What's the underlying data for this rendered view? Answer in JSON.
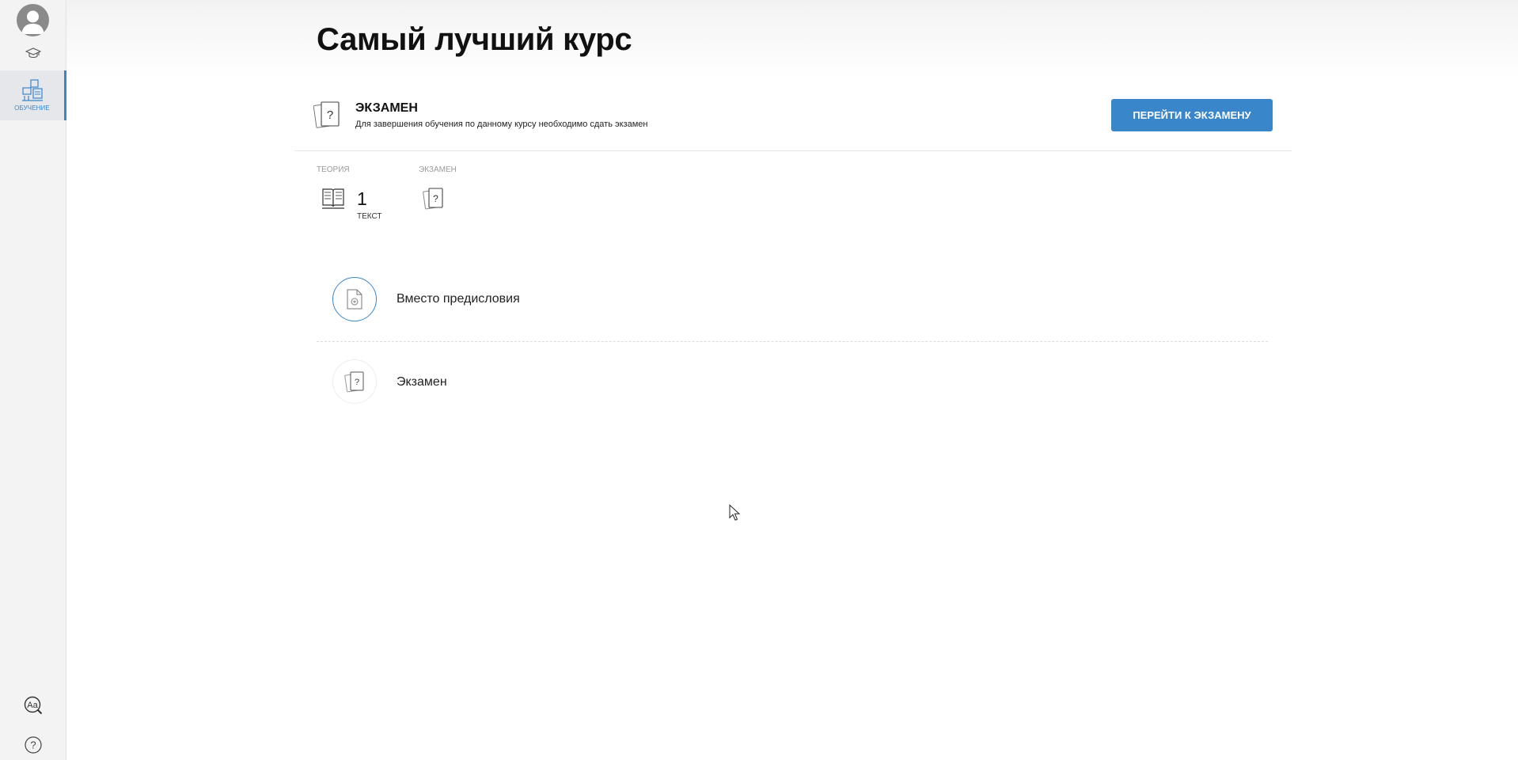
{
  "sidebar": {
    "avatar": "user-avatar",
    "nav_items": [
      {
        "label": "ОБУЧЕНИЕ",
        "icon": "learning-icon",
        "active": true
      }
    ],
    "accent_color": "#3a86cb"
  },
  "page": {
    "title": "Самый лучший курс"
  },
  "exam_banner": {
    "title": "ЭКЗАМЕН",
    "description": "Для завершения обучения по данному курсу необходимо сдать экзамен",
    "button_label": "ПЕРЕЙТИ К ЭКЗАМЕНУ",
    "button_color": "#3a86cb"
  },
  "stats": {
    "theory_label": "ТЕОРИЯ",
    "theory_count": "1",
    "theory_unit": "ТЕКСТ",
    "exam_label": "ЭКЗАМЕН"
  },
  "lessons": [
    {
      "title": "Вместо предисловия",
      "icon": "document-icon"
    },
    {
      "title": "Экзамен",
      "icon": "exam-cards-icon"
    }
  ]
}
